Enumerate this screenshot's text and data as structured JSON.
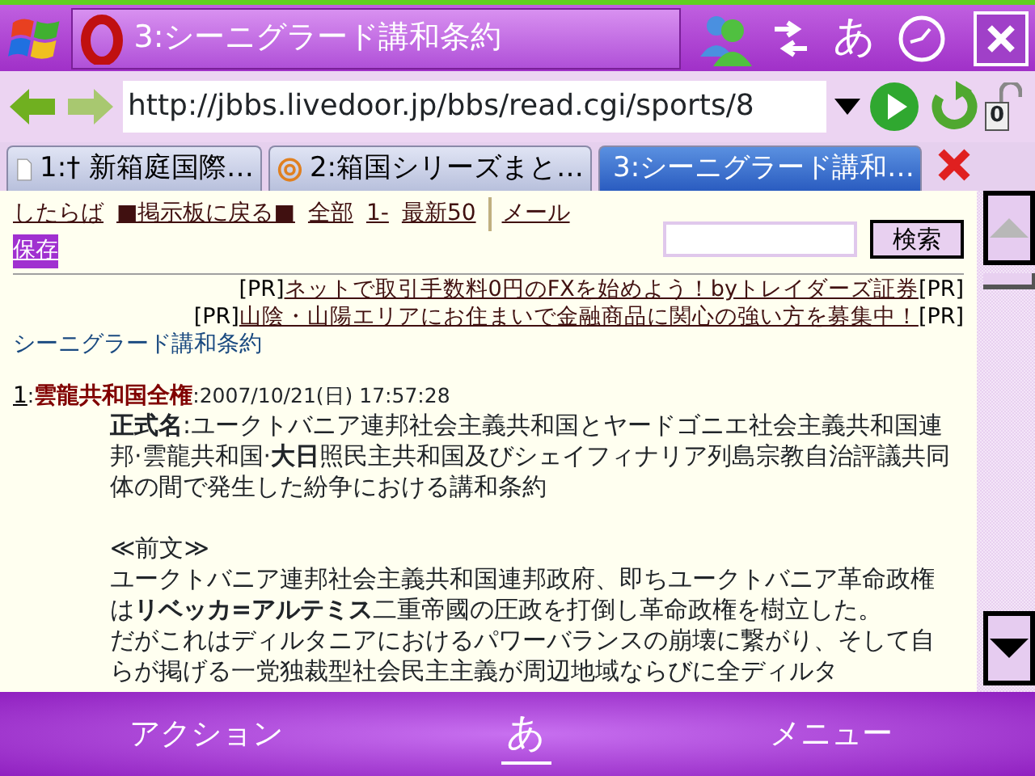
{
  "title_bar": {
    "title": "3:シーニグラード講和条約",
    "input_mode": "あ"
  },
  "address_bar": {
    "url": "http://jbbs.livedoor.jp/bbs/read.cgi/sports/8",
    "lock_count": "0"
  },
  "tabs": [
    {
      "label": "1:† 新箱庭国際…",
      "selected": false,
      "kind": "page"
    },
    {
      "label": "2:箱国シリーズまと…",
      "selected": false,
      "kind": "at"
    },
    {
      "label": "3:シーニグラード講和…",
      "selected": true,
      "kind": "loading"
    }
  ],
  "nav_links": [
    {
      "label": "したらば",
      "highlighted": false
    },
    {
      "label": "■掲示板に戻る■",
      "highlighted": false
    },
    {
      "label": "全部",
      "highlighted": false
    },
    {
      "label": "1-",
      "highlighted": false
    },
    {
      "label": "最新50",
      "highlighted": false
    },
    {
      "label": "メール",
      "highlighted": false
    },
    {
      "label": "保存",
      "highlighted": true
    }
  ],
  "search": {
    "button": "検索"
  },
  "ads": [
    {
      "prefix": "[PR]",
      "link": "ネットで取引手数料0円のFXを始めよう！byトレイダーズ証券",
      "suffix": "[PR]"
    },
    {
      "prefix": "[PR]",
      "link": "山陰・山陽エリアにお住まいで金融商品に関心の強い方を募集中！",
      "suffix": "[PR]"
    }
  ],
  "thread_title": "シーニグラード講和条約",
  "post": {
    "number": "1",
    "separators": [
      ":",
      ":"
    ],
    "name": "雲龍共和国全権",
    "date": "2007/10/21(日) 17:57:28",
    "body": [
      {
        "kind": "text",
        "text": "**正式名**:ユークトバニア連邦社会主義共和国とヤードゴニエ社会主義共和国連邦·雲龍共和国·**大日**照民主共和国及びシェイフィナリア列島宗教自治評議共同体の間で発生した紛争における講和条約"
      },
      {
        "kind": "heading",
        "text": "≪前文≫"
      },
      {
        "kind": "text",
        "text": "ユークトバニア連邦社会主義共和国連邦政府、即ちユークトバニア革命政権は**リベッカ=アルテミス**二重帝國の圧政を打倒し革命政権を樹立した。"
      },
      {
        "kind": "text",
        "text": "だがこれはディルタニアにおけるパワーバランスの崩壊に繋がり、そして自らが掲げる一党独裁型社会民主主義が周辺地域ならびに全ディルタ"
      }
    ]
  },
  "softkeys": {
    "left": "アクション",
    "center": "あ",
    "right": "メニュー"
  }
}
